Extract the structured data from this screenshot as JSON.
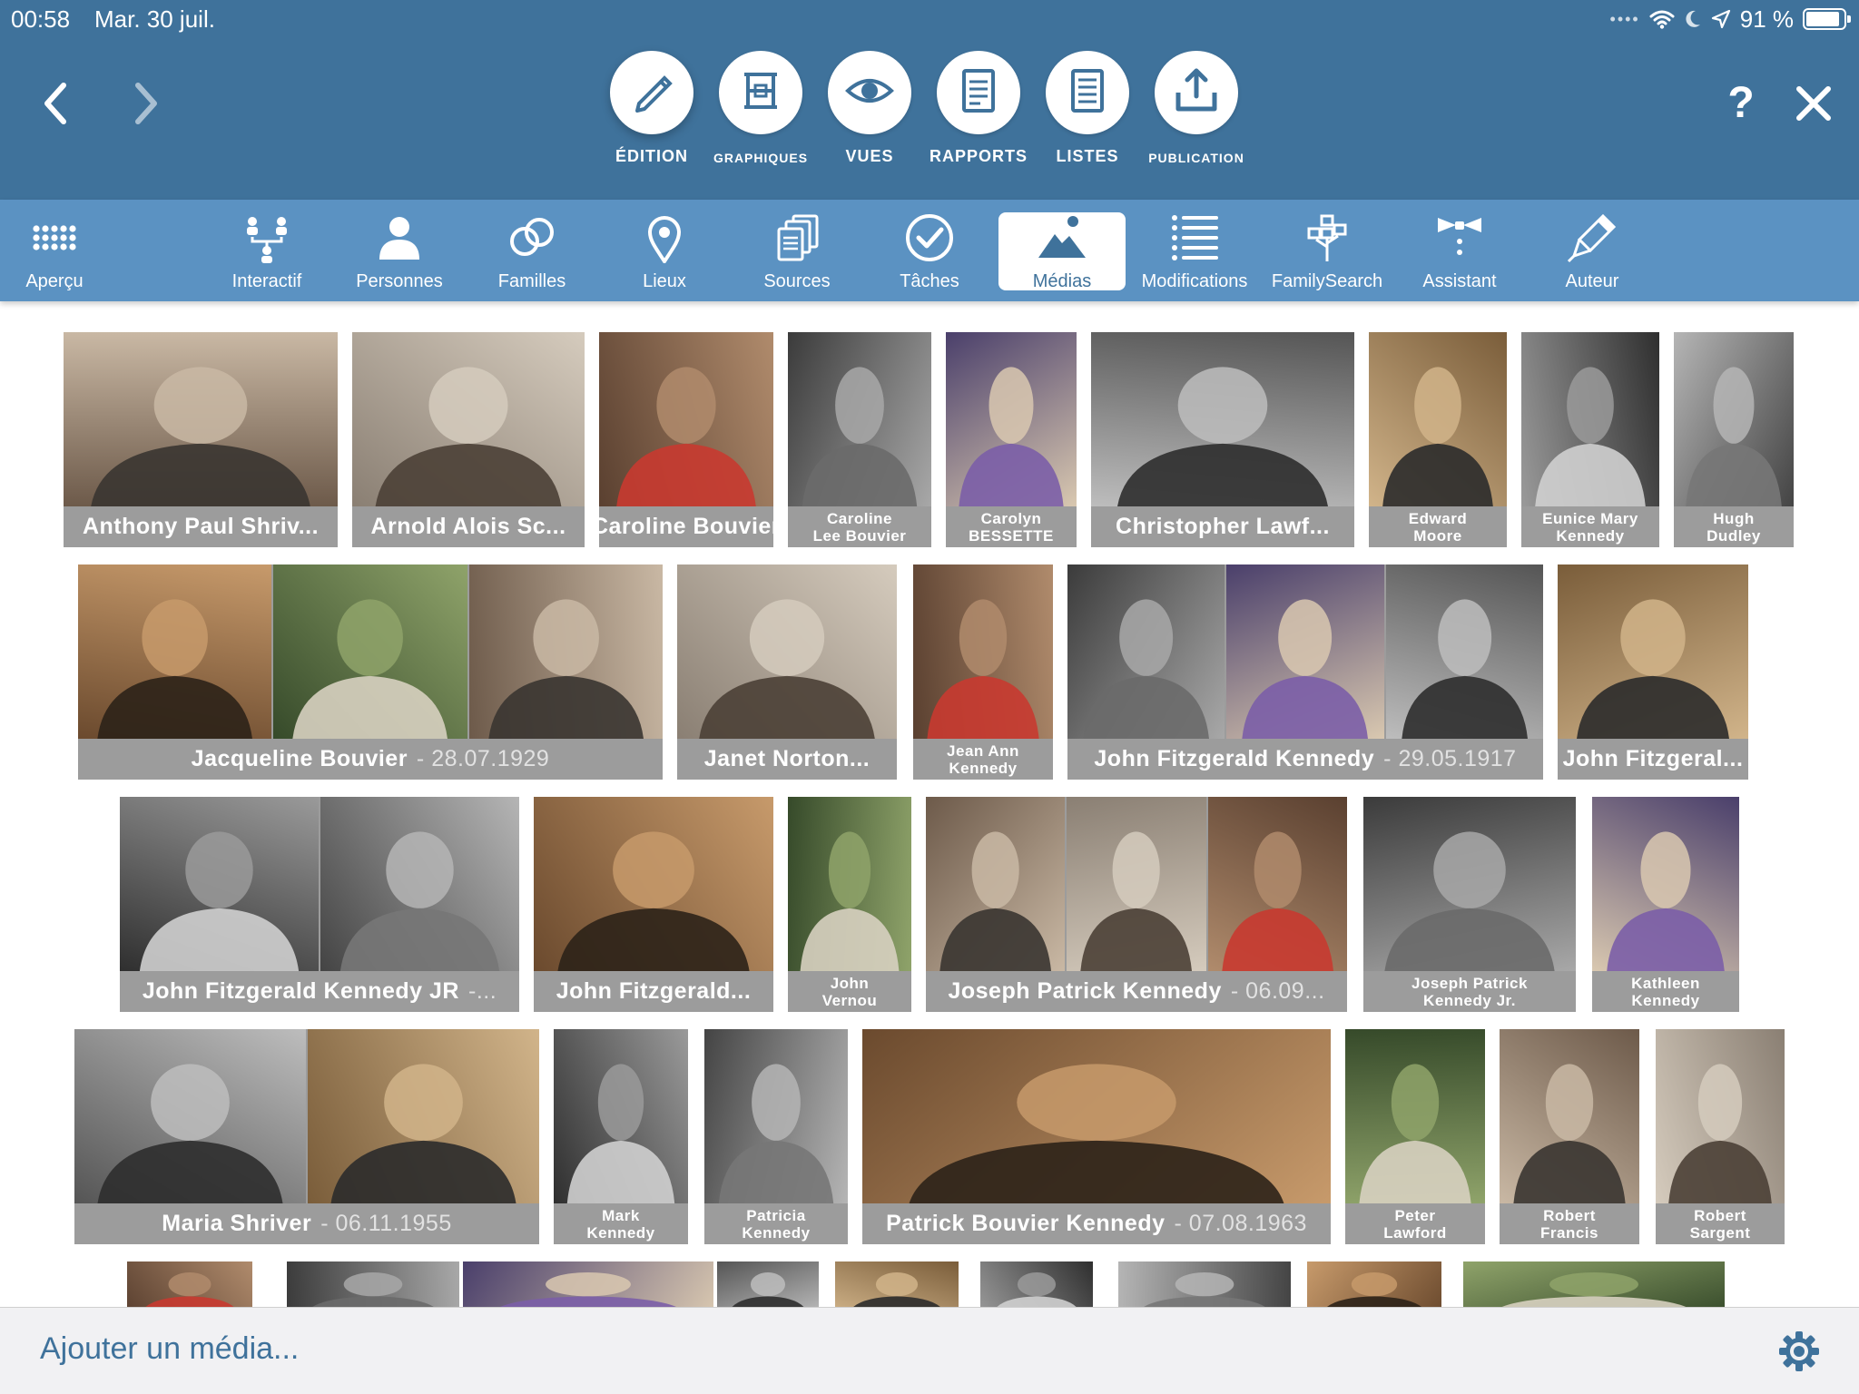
{
  "status_bar": {
    "time": "00:58",
    "date": "Mar. 30 juil.",
    "battery": "91 %",
    "battery_level": 0.91
  },
  "nav": {
    "help": "?"
  },
  "modes": [
    {
      "label": "ÉDITION",
      "icon": "pencil-icon",
      "active": true,
      "small": false
    },
    {
      "label": "GRAPHIQUES",
      "icon": "chart-icon",
      "active": false,
      "small": true
    },
    {
      "label": "VUES",
      "icon": "eye-icon",
      "active": false,
      "small": false
    },
    {
      "label": "RAPPORTS",
      "icon": "report-icon",
      "active": false,
      "small": false
    },
    {
      "label": "LISTES",
      "icon": "list-doc-icon",
      "active": false,
      "small": false
    },
    {
      "label": "PUBLICATION",
      "icon": "upload-icon",
      "active": false,
      "small": true
    }
  ],
  "toolbar": [
    {
      "label": "Aperçu",
      "icon": "grid-icon",
      "active": false
    },
    {
      "label": "Interactif",
      "icon": "tree-icon",
      "active": false
    },
    {
      "label": "Personnes",
      "icon": "person-icon",
      "active": false
    },
    {
      "label": "Familles",
      "icon": "rings-icon",
      "active": false
    },
    {
      "label": "Lieux",
      "icon": "pin-icon",
      "active": false
    },
    {
      "label": "Sources",
      "icon": "documents-icon",
      "active": false
    },
    {
      "label": "Tâches",
      "icon": "check-icon",
      "active": false
    },
    {
      "label": "Médias",
      "icon": "image-icon",
      "active": true
    },
    {
      "label": "Modifications",
      "icon": "list-icon",
      "active": false
    },
    {
      "label": "FamilySearch",
      "icon": "familysearch-icon",
      "active": false
    },
    {
      "label": "Assistant",
      "icon": "bowtie-icon",
      "active": false
    },
    {
      "label": "Auteur",
      "icon": "pen-icon",
      "active": false
    }
  ],
  "media_rows": [
    [
      {
        "name": "Anthony Paul Shriv...",
        "date": "",
        "photos": 1
      },
      {
        "name": "Arnold Alois Sc...",
        "date": "",
        "photos": 1
      },
      {
        "name": "Caroline Bouvier",
        "date": "",
        "photos": 1
      },
      {
        "name": "Caroline\nLee Bouvier",
        "date": "",
        "photos": 1
      },
      {
        "name": "Carolyn\nBESSETTE",
        "date": "",
        "photos": 1
      },
      {
        "name": "Christopher Lawf...",
        "date": "",
        "photos": 1
      },
      {
        "name": "Edward\nMoore",
        "date": "",
        "photos": 1
      },
      {
        "name": "Eunice Mary\nKennedy",
        "date": "",
        "photos": 1
      },
      {
        "name": "Hugh\nDudley",
        "date": "",
        "photos": 1
      }
    ],
    [
      {
        "name": "Jacqueline Bouvier",
        "date": "- 28.07.1929",
        "photos": 3
      },
      {
        "name": "Janet Norton...",
        "date": "",
        "photos": 1
      },
      {
        "name": "Jean Ann\nKennedy",
        "date": "",
        "photos": 1
      },
      {
        "name": "John Fitzgerald Kennedy",
        "date": "- 29.05.1917",
        "photos": 3
      },
      {
        "name": "John Fitzgeral...",
        "date": "",
        "photos": 1
      }
    ],
    [
      {
        "name": "John Fitzgerald Kennedy JR",
        "date": "-...",
        "photos": 2
      },
      {
        "name": "John Fitzgerald...",
        "date": "",
        "photos": 1
      },
      {
        "name": "John\nVernou",
        "date": "",
        "photos": 1
      },
      {
        "name": "Joseph Patrick Kennedy",
        "date": "- 06.09...",
        "photos": 3
      },
      {
        "name": "Joseph Patrick\nKennedy Jr.",
        "date": "",
        "photos": 1
      },
      {
        "name": "Kathleen\nKennedy",
        "date": "",
        "photos": 1
      }
    ],
    [
      {
        "name": "Maria Shriver",
        "date": "- 06.11.1955",
        "photos": 2
      },
      {
        "name": "Mark\nKennedy",
        "date": "",
        "photos": 1
      },
      {
        "name": "Patricia\nKennedy",
        "date": "",
        "photos": 1
      },
      {
        "name": "Patrick Bouvier Kennedy",
        "date": "- 07.08.1963",
        "photos": 1
      },
      {
        "name": "Peter\nLawford",
        "date": "",
        "photos": 1
      },
      {
        "name": "Robert\nFrancis",
        "date": "",
        "photos": 1
      },
      {
        "name": "Robert\nSargent",
        "date": "",
        "photos": 1
      }
    ]
  ],
  "partial_row_photos": 11,
  "bottom_bar": {
    "add_media": "Ajouter un média..."
  },
  "colors": {
    "header": "#3f729b",
    "toolbar": "#5b92c2",
    "caption": "#9c9c9c",
    "accent": "#3f729b"
  }
}
